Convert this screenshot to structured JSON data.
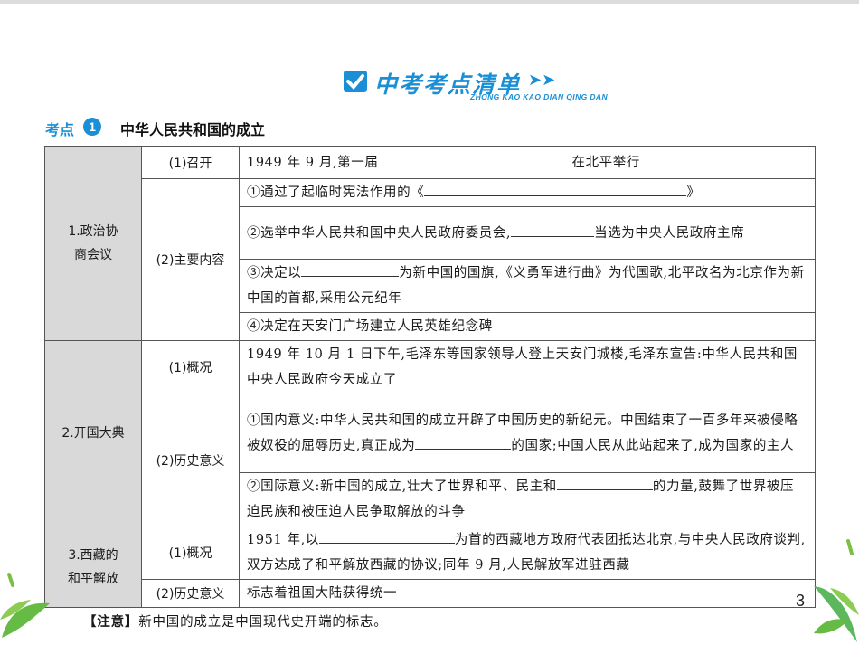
{
  "banner": {
    "title": "中考考点清单",
    "subtitle": "ZHONG KAO KAO DIAN QING DAN",
    "arrow": "➤➤"
  },
  "kaodian": {
    "label": "考点",
    "number": "1",
    "title": "中华人民共和国的成立"
  },
  "table": {
    "sec1": {
      "label_line1": "1.政治协",
      "label_line2": "商会议",
      "r1_sub": "(1)召开",
      "r1_pre": "1949 年 9 月,第一届",
      "r1_post": "在北平举行",
      "r2_sub": "(2)主要内容",
      "r2a_pre": "①通过了起临时宪法作用的《",
      "r2a_post": "》",
      "r2b_pre": "②选举中华人民共和国中央人民政府委员会,",
      "r2b_post": "当选为中央人民政府主席",
      "r2c_pre": "③决定以",
      "r2c_post": "为新中国的国旗,《义勇军进行曲》为代国歌,北平改名为北京作为新中国的首都,采用公元纪年",
      "r2d": "④决定在天安门广场建立人民英雄纪念碑"
    },
    "sec2": {
      "label": "2.开国大典",
      "r1_sub": "(1)概况",
      "r1_text": "1949 年 10 月 1 日下午,毛泽东等国家领导人登上天安门城楼,毛泽东宣告:中华人民共和国中央人民政府今天成立了",
      "r2_sub": "(2)历史意义",
      "r2a_pre": "①国内意义:中华人民共和国的成立开辟了中国历史的新纪元。中国结束了一百多年来被侵略被奴役的屈辱历史,真正成为",
      "r2a_post": "的国家;中国人民从此站起来了,成为国家的主人",
      "r2b_pre": "②国际意义:新中国的成立,壮大了世界和平、民主和",
      "r2b_post": "的力量,鼓舞了世界被压迫民族和被压迫人民争取解放的斗争"
    },
    "sec3": {
      "label_line1": "3.西藏的",
      "label_line2": "和平解放",
      "r1_sub": "(1)概况",
      "r1_pre": "1951 年,以",
      "r1_post": "为首的西藏地方政府代表团抵达北京,与中央人民政府谈判,双方达成了和平解放西藏的协议;同年 9 月,人民解放军进驻西藏",
      "r2_sub": "(2)历史意义",
      "r2_text": "标志着祖国大陆获得统一"
    }
  },
  "note": {
    "tag": "【注意】",
    "text": "新中国的成立是中国现代史开端的标志。"
  },
  "page_number": "3",
  "colors": {
    "accent": "#1a8fd6",
    "section_bg": "#d9d9d9",
    "leaf_green": "#5cb85c"
  }
}
